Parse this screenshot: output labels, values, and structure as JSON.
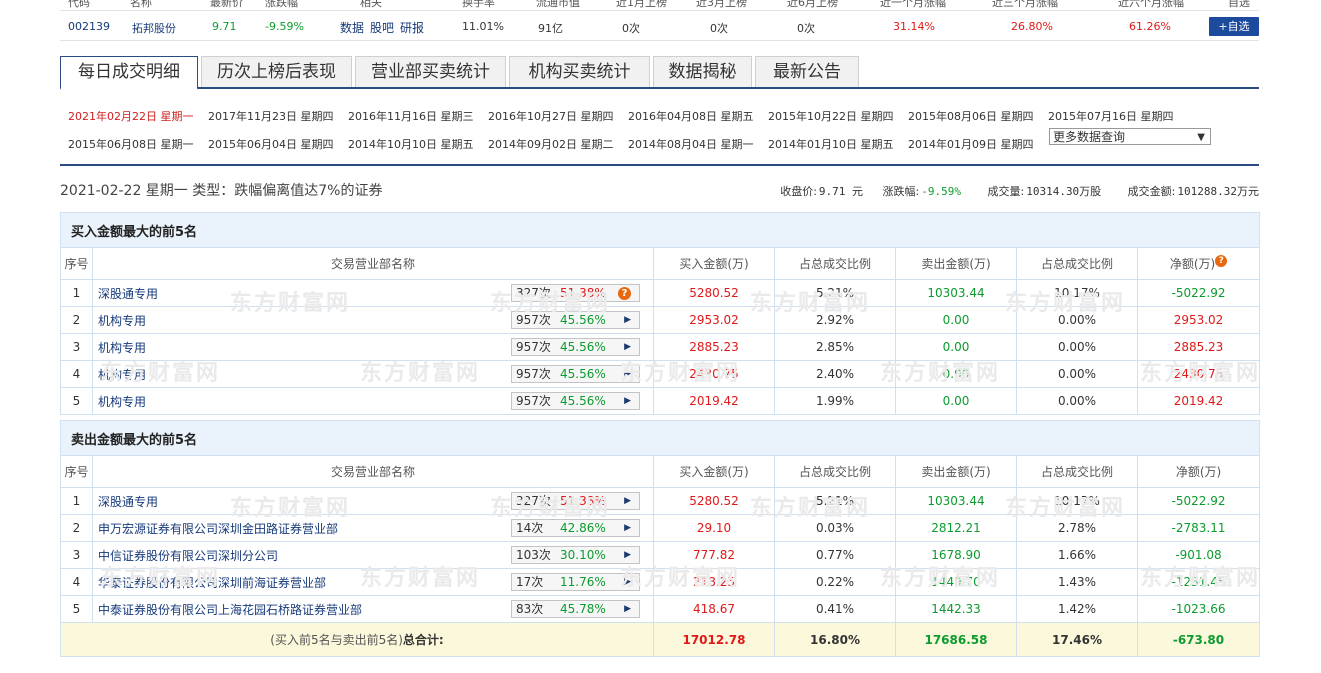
{
  "header_cols": [
    "代码",
    "名称",
    "最新价",
    "涨跌幅",
    "相关",
    "换手率",
    "流通市值",
    "近1月上榜",
    "近3月上榜",
    "近6月上榜",
    "近一个月涨幅",
    "近三个月涨幅",
    "近六个月涨幅",
    "自选"
  ],
  "stock": {
    "code": "002139",
    "name": "拓邦股份",
    "price": "9.71",
    "change": "-9.59%",
    "links": [
      "数据",
      "股吧",
      "研报"
    ],
    "turnover": "11.01%",
    "float_cap": "91亿",
    "m1": "0次",
    "m3": "0次",
    "m6": "0次",
    "r1": "31.14%",
    "r3": "26.80%",
    "r6": "61.26%",
    "add": "+自选"
  },
  "tabs": [
    "每日成交明细",
    "历次上榜后表现",
    "营业部买卖统计",
    "机构买卖统计",
    "数据揭秘",
    "最新公告"
  ],
  "dates": [
    [
      "2021年02月22日  星期一",
      "2017年11月23日  星期四",
      "2016年11月16日  星期三",
      "2016年10月27日  星期四",
      "2016年04月08日  星期五",
      "2015年10月22日  星期四",
      "2015年08月06日  星期四",
      "2015年07月16日  星期四"
    ],
    [
      "2015年06月08日  星期一",
      "2015年06月04日  星期四",
      "2014年10月10日  星期五",
      "2014年09月02日  星期二",
      "2014年08月04日  星期一",
      "2014年01月10日  星期五",
      "2014年01月09日  星期四"
    ]
  ],
  "more_query": "更多数据查询",
  "summary": {
    "title": "2021-02-22 星期一  类型：跌幅偏离值达7%的证券",
    "close_label": "收盘价:",
    "close": "9.71 元",
    "chg_label": "涨跌幅:",
    "chg": "-9.59%",
    "vol_label": "成交量:",
    "vol": "10314.30万股",
    "amt_label": "成交金额:",
    "amt": "101288.32万元"
  },
  "cols": [
    "序号",
    "交易营业部名称",
    "买入金额(万)",
    "占总成交比例",
    "卖出金额(万)",
    "占总成交比例",
    "净额(万)"
  ],
  "buy_title": "买入金额最大的前5名",
  "sell_title": "卖出金额最大的前5名",
  "buy_rows": [
    {
      "n": "1",
      "name": "深股通专用",
      "cnt": "327次",
      "pct": "51.38%",
      "buy": "5280.52",
      "bp": "5.21%",
      "sell": "10303.44",
      "sp": "10.17%",
      "net": "-5022.92",
      "q": true
    },
    {
      "n": "2",
      "name": "机构专用",
      "cnt": "957次",
      "pct": "45.56%",
      "buy": "2953.02",
      "bp": "2.92%",
      "sell": "0.00",
      "sp": "0.00%",
      "net": "2953.02"
    },
    {
      "n": "3",
      "name": "机构专用",
      "cnt": "957次",
      "pct": "45.56%",
      "buy": "2885.23",
      "bp": "2.85%",
      "sell": "0.00",
      "sp": "0.00%",
      "net": "2885.23"
    },
    {
      "n": "4",
      "name": "机构专用",
      "cnt": "957次",
      "pct": "45.56%",
      "buy": "2430.75",
      "bp": "2.40%",
      "sell": "0.00",
      "sp": "0.00%",
      "net": "2430.75"
    },
    {
      "n": "5",
      "name": "机构专用",
      "cnt": "957次",
      "pct": "45.56%",
      "buy": "2019.42",
      "bp": "1.99%",
      "sell": "0.00",
      "sp": "0.00%",
      "net": "2019.42"
    }
  ],
  "sell_rows": [
    {
      "n": "1",
      "name": "深股通专用",
      "cnt": "327次",
      "pct": "51.38%",
      "buy": "5280.52",
      "bp": "5.21%",
      "sell": "10303.44",
      "sp": "10.17%",
      "net": "-5022.92"
    },
    {
      "n": "2",
      "name": "申万宏源证券有限公司深圳金田路证券营业部",
      "cnt": "14次",
      "pct": "42.86%",
      "buy": "29.10",
      "bp": "0.03%",
      "sell": "2812.21",
      "sp": "2.78%",
      "net": "-2783.11"
    },
    {
      "n": "3",
      "name": "中信证券股份有限公司深圳分公司",
      "cnt": "103次",
      "pct": "30.10%",
      "buy": "777.82",
      "bp": "0.77%",
      "sell": "1678.90",
      "sp": "1.66%",
      "net": "-901.08"
    },
    {
      "n": "4",
      "name": "华泰证券股份有限公司深圳前海证券营业部",
      "cnt": "17次",
      "pct": "11.76%",
      "buy": "218.25",
      "bp": "0.22%",
      "sell": "1449.70",
      "sp": "1.43%",
      "net": "-1231.45"
    },
    {
      "n": "5",
      "name": "中泰证券股份有限公司上海花园石桥路证券营业部",
      "cnt": "83次",
      "pct": "45.78%",
      "buy": "418.67",
      "bp": "0.41%",
      "sell": "1442.33",
      "sp": "1.42%",
      "net": "-1023.66"
    }
  ],
  "total": {
    "label_a": "(买入前5名与卖出前5名)",
    "label_b": "总合计:",
    "buy": "17012.78",
    "bp": "16.80%",
    "sell": "17686.58",
    "sp": "17.46%",
    "net": "-673.80"
  },
  "watermark": "东方财富网"
}
